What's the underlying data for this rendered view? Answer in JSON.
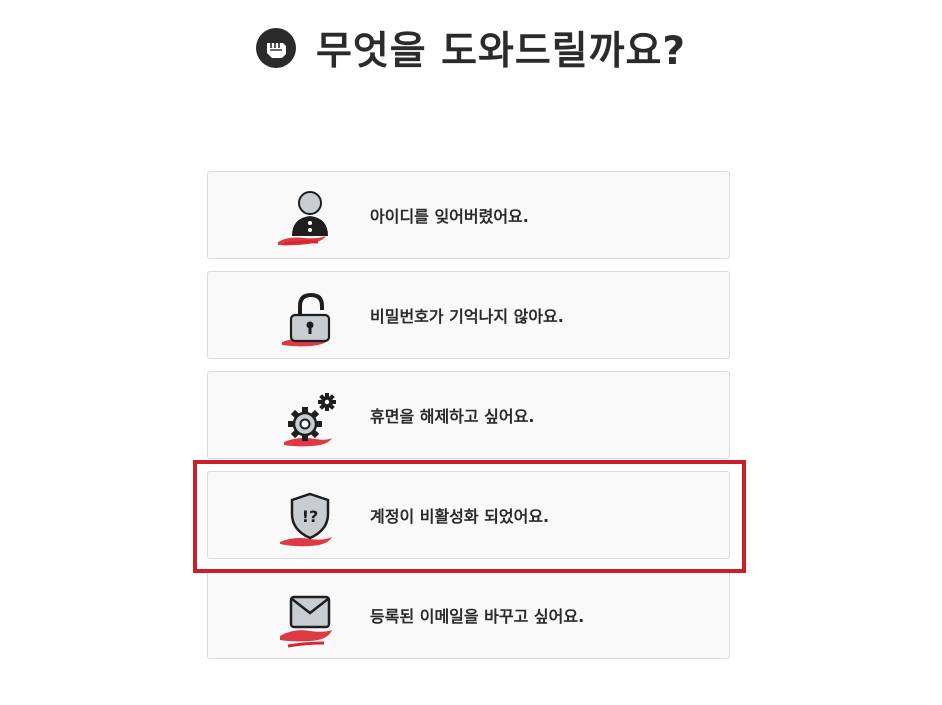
{
  "header": {
    "title": "무엇을 도와드릴까요?",
    "logo_icon": "fist-logo-icon"
  },
  "options": [
    {
      "label": "아이디를 잊어버렸어요.",
      "icon": "person-icon"
    },
    {
      "label": "비밀번호가 기억나지 않아요.",
      "icon": "padlock-icon"
    },
    {
      "label": "휴면을 해제하고 싶어요.",
      "icon": "gears-icon"
    },
    {
      "label": "계정이 비활성화 되었어요.",
      "icon": "shield-alert-icon"
    },
    {
      "label": "등록된 이메일을 바꾸고 싶어요.",
      "icon": "envelope-icon"
    }
  ],
  "colors": {
    "accent": "#cc1f2a",
    "brush": "#d9262f",
    "icon_fill": "#c8cdd2",
    "icon_stroke": "#1e1e1e"
  }
}
